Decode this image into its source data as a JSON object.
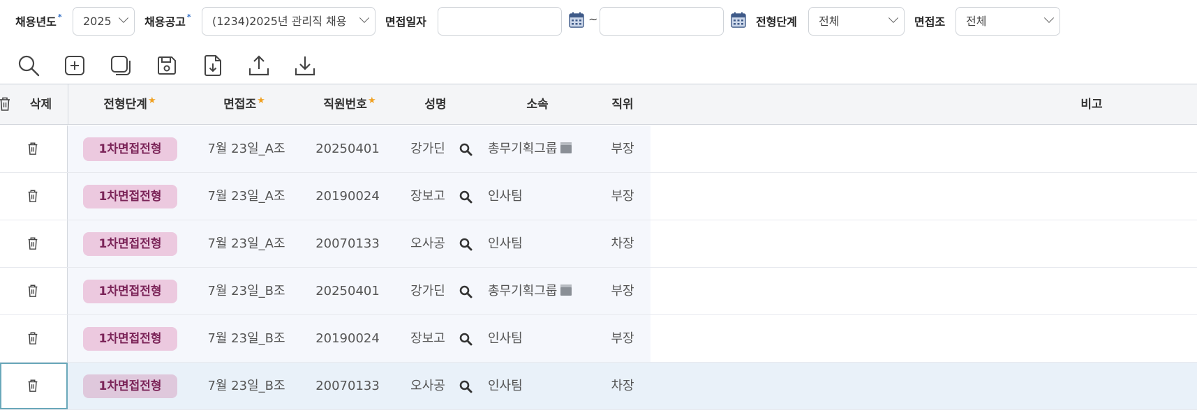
{
  "filters": {
    "year_label": "채용년도",
    "year_value": "2025",
    "notice_label": "채용공고",
    "notice_value": "(1234)2025년 관리직 채용",
    "date_label": "면접일자",
    "date_from": "",
    "date_to": "",
    "date_sep": "~",
    "stage_label": "전형단계",
    "stage_value": "전체",
    "group_label": "면접조",
    "group_value": "전체",
    "required_mark": "*"
  },
  "toolbar": {
    "icons": [
      "search-icon",
      "add-icon",
      "copy-icon",
      "save-icon",
      "import-icon",
      "upload-icon",
      "download-icon"
    ]
  },
  "grid": {
    "columns": {
      "delete": "삭제",
      "stage": "전형단계",
      "group": "면접조",
      "emp_no": "직원번호",
      "name": "성명",
      "dept": "소속",
      "position": "직위",
      "note": "비고"
    },
    "required_mark": "★",
    "rows": [
      {
        "stage": "1차면접전형",
        "group": "7월 23일_A조",
        "emp_no": "20250401",
        "name": "강가딘",
        "dept": "총무기획그룹",
        "dept_icon": true,
        "position": "부장",
        "note": "",
        "selected": false
      },
      {
        "stage": "1차면접전형",
        "group": "7월 23일_A조",
        "emp_no": "20190024",
        "name": "장보고",
        "dept": "인사팀",
        "dept_icon": false,
        "position": "부장",
        "note": "",
        "selected": false
      },
      {
        "stage": "1차면접전형",
        "group": "7월 23일_A조",
        "emp_no": "20070133",
        "name": "오사공",
        "dept": "인사팀",
        "dept_icon": false,
        "position": "차장",
        "note": "",
        "selected": false
      },
      {
        "stage": "1차면접전형",
        "group": "7월 23일_B조",
        "emp_no": "20250401",
        "name": "강가딘",
        "dept": "총무기획그룹",
        "dept_icon": true,
        "position": "부장",
        "note": "",
        "selected": false
      },
      {
        "stage": "1차면접전형",
        "group": "7월 23일_B조",
        "emp_no": "20190024",
        "name": "장보고",
        "dept": "인사팀",
        "dept_icon": false,
        "position": "부장",
        "note": "",
        "selected": false
      },
      {
        "stage": "1차면접전형",
        "group": "7월 23일_B조",
        "emp_no": "20070133",
        "name": "오사공",
        "dept": "인사팀",
        "dept_icon": false,
        "position": "차장",
        "note": "",
        "selected": true
      }
    ]
  },
  "colors": {
    "badge_bg": "#ecc9df",
    "badge_text": "#7b2458",
    "required_star": "#f0a020",
    "required_dot": "#2e6cc4",
    "selected_row": "#e9f1f9"
  }
}
